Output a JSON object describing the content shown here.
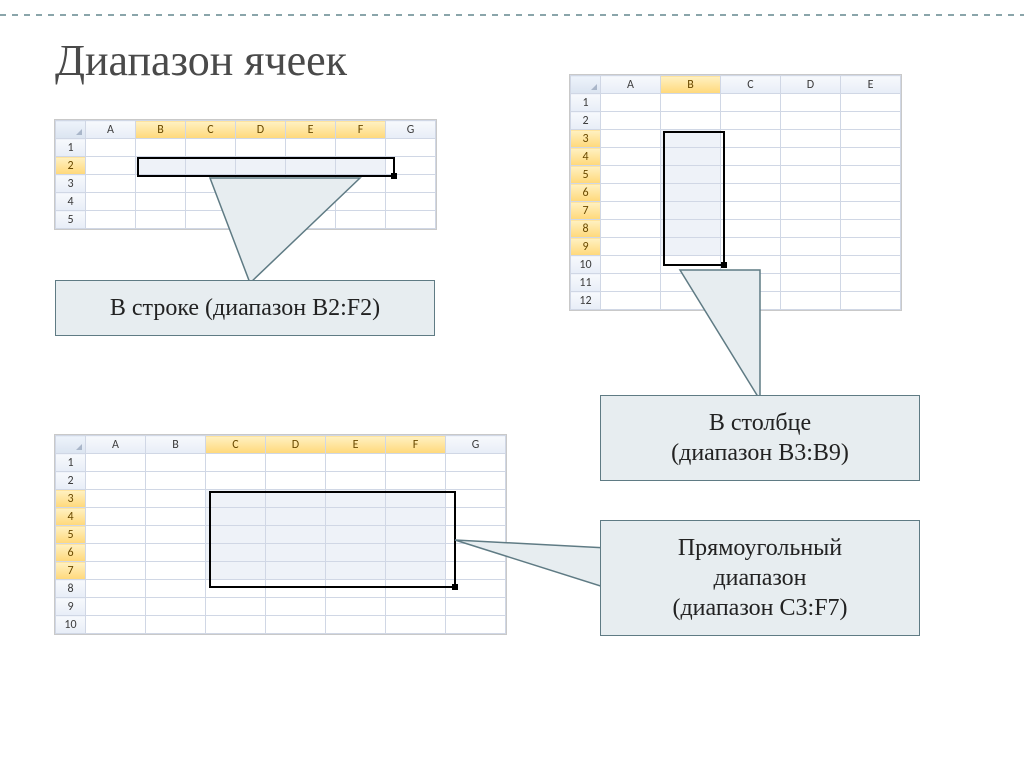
{
  "title": "Диапазон ячеек",
  "sheet_row": {
    "cols": [
      "A",
      "B",
      "C",
      "D",
      "E",
      "F",
      "G"
    ],
    "rows": [
      "1",
      "2",
      "3",
      "4",
      "5"
    ]
  },
  "sheet_col": {
    "cols": [
      "A",
      "B",
      "C",
      "D",
      "E"
    ],
    "rows": [
      "1",
      "2",
      "3",
      "4",
      "5",
      "6",
      "7",
      "8",
      "9",
      "10",
      "11",
      "12"
    ]
  },
  "sheet_rect": {
    "cols": [
      "A",
      "B",
      "C",
      "D",
      "E",
      "F",
      "G"
    ],
    "rows": [
      "1",
      "2",
      "3",
      "4",
      "5",
      "6",
      "7",
      "8",
      "9",
      "10"
    ]
  },
  "callouts": {
    "row": "В строке (диапазон  B2:F2)",
    "col_l1": "В столбце",
    "col_l2": "(диапазон  B3:B9)",
    "rect_l1": "Прямоугольный",
    "rect_l2": "диапазон",
    "rect_l3": "(диапазон  C3:F7)"
  }
}
